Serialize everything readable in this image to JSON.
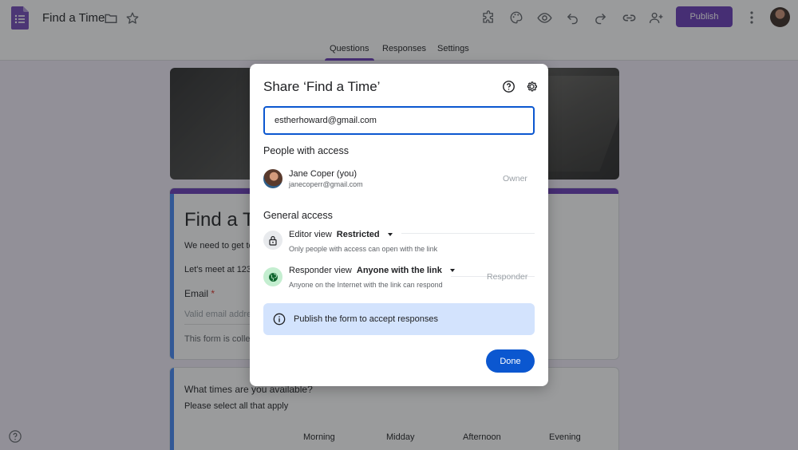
{
  "header": {
    "title": "Find a Time",
    "publish_label": "Publish",
    "icons": [
      "forms-logo-icon",
      "folder-icon",
      "star-icon",
      "addon-icon",
      "palette-icon",
      "preview-icon",
      "undo-icon",
      "redo-icon",
      "link-icon",
      "add-collaborator-icon",
      "more-vert-icon"
    ]
  },
  "tabs": [
    {
      "label": "Questions",
      "active": true
    },
    {
      "label": "Responses",
      "active": false
    },
    {
      "label": "Settings",
      "active": false
    }
  ],
  "form": {
    "title": "Find a T",
    "desc1": "We need to get to",
    "desc2": "Let's meet at 123",
    "email_label": "Email",
    "required_mark": "*",
    "email_placeholder": "Valid email addre",
    "collect_note": "This form is colle",
    "question_title": "What times are you available?",
    "question_sub": "Please select all that apply",
    "columns": [
      "Morning",
      "Midday",
      "Afternoon",
      "Evening"
    ]
  },
  "dialog": {
    "title": "Share ‘Find a Time’",
    "input_value": "estherhoward@gmail.com",
    "people_heading": "People with access",
    "person": {
      "name": "Jane Coper (you)",
      "email": "janecoperr@gmail.com",
      "role": "Owner"
    },
    "general_heading": "General access",
    "editor": {
      "label": "Editor view",
      "value": "Restricted",
      "desc": "Only people with access can open with the link"
    },
    "responder": {
      "label": "Responder view",
      "value": "Anyone with the link",
      "desc": "Anyone on the Internet with the link can respond",
      "role": "Responder"
    },
    "info_text": "Publish the form to accept responses",
    "done_label": "Done"
  },
  "colors": {
    "brand": "#673ab7",
    "accent": "#0b57d0",
    "info_bg": "#d3e3fd",
    "responder_icon_bg": "#c4eed0"
  }
}
